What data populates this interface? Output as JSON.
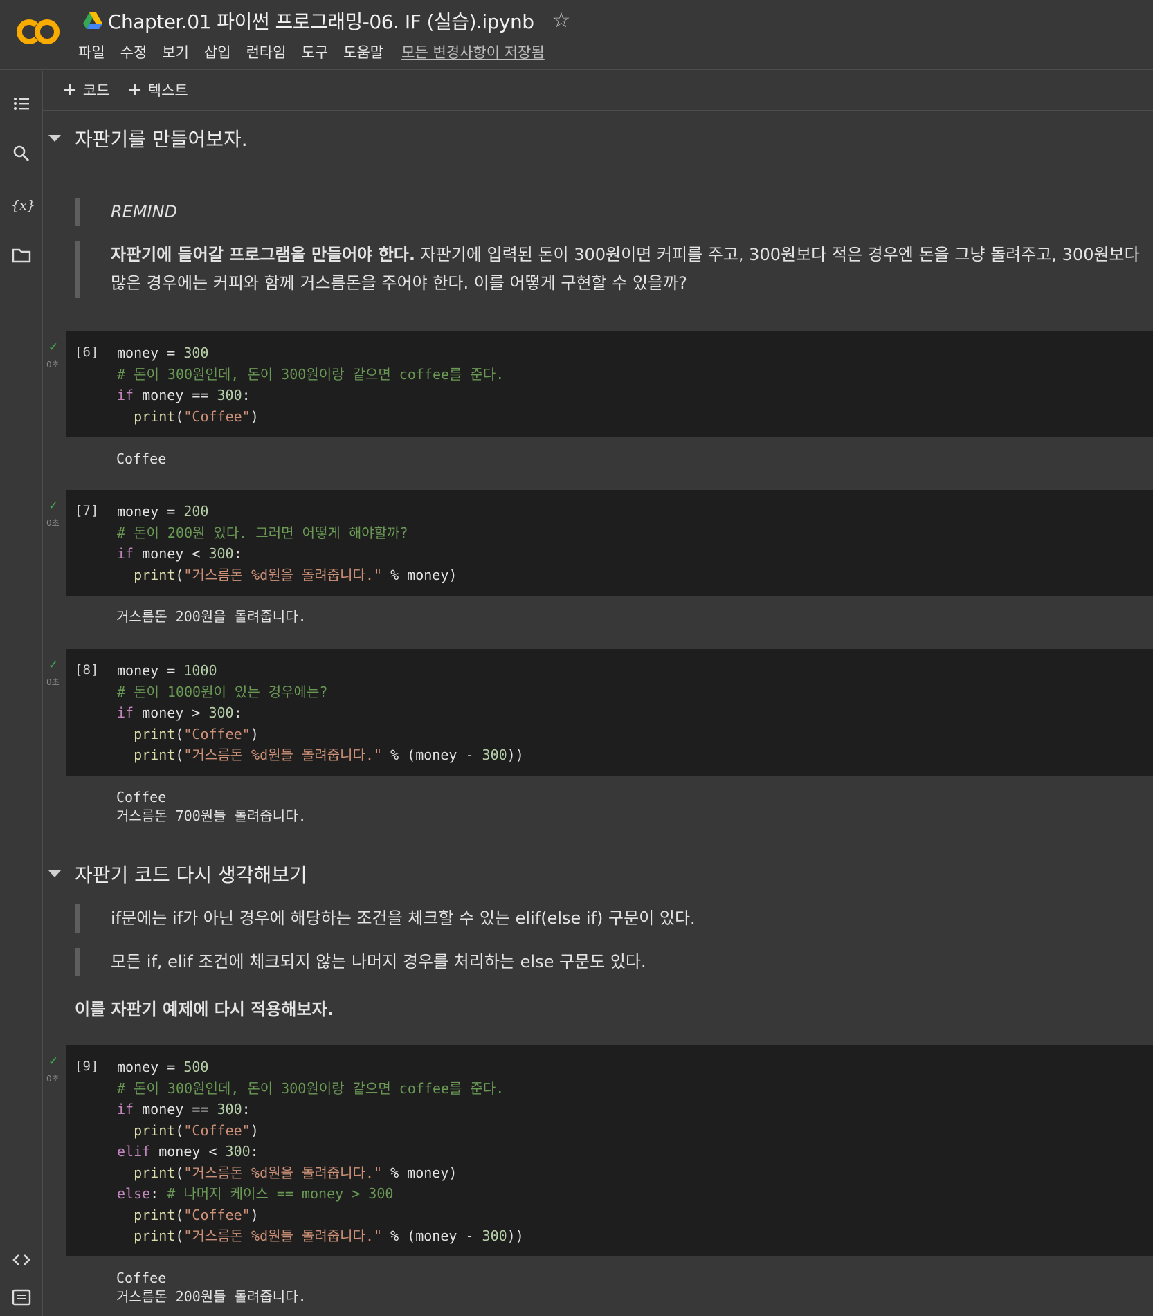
{
  "header": {
    "title": "Chapter.01 파이썬 프로그래밍-06. IF (실습).ipynb",
    "menu": [
      "파일",
      "수정",
      "보기",
      "삽입",
      "런타임",
      "도구",
      "도움말"
    ],
    "saved_status": "모든 변경사항이 저장됨",
    "logo_text": "CO"
  },
  "toolbar": {
    "add_code": "코드",
    "add_text": "텍스트"
  },
  "colors": {
    "accent_orange": "#f9ab00",
    "check_green": "#3fb34f",
    "background": "#383838",
    "code_bg": "#1e1e1e"
  },
  "sections": [
    {
      "heading": "자판기를 만들어보자.",
      "remind": "REMIND",
      "desc_bold": "자판기에 들어갈 프로그램을 만들어야 한다.",
      "desc_line1": " 자판기에 입력된 돈이 300원이면 커피를 주고, 300원보다 적은 경우엔 돈을 그냥 돌려주고, 300원보다",
      "desc_line2": "많은 경우에는 커피와 함께 거스름돈을 주어야 한다. 이를 어떻게 구현할 수 있을까?"
    },
    {
      "heading": "자판기 코드 다시 생각해보기",
      "bq1": "if문에는 if가 아닌 경우에 해당하는 조건을 체크할 수 있는 elif(else if) 구문이 있다.",
      "bq2": "모든 if, elif 조건에 체크되지 않는 나머지 경우를 처리하는 else 구문도 있다.",
      "apply": "이를 자판기 예제에 다시 적용해보자."
    }
  ],
  "cells": [
    {
      "exec": "[6]",
      "time": "0초",
      "lines": [
        [
          [
            "var",
            "money = "
          ],
          [
            "num",
            "300"
          ]
        ],
        [
          [
            "cm",
            "# 돈이 300원인데, 돈이 300원이랑 같으면 coffee를 준다."
          ]
        ],
        [
          [
            "kw",
            "if"
          ],
          [
            "var",
            " money == "
          ],
          [
            "num",
            "300"
          ],
          [
            "var",
            ":"
          ]
        ],
        [
          [
            "var",
            "  "
          ],
          [
            "fn",
            "print"
          ],
          [
            "var",
            "("
          ],
          [
            "str",
            "\"Coffee\""
          ],
          [
            "var",
            ")"
          ]
        ]
      ],
      "output": [
        "Coffee"
      ]
    },
    {
      "exec": "[7]",
      "time": "0초",
      "lines": [
        [
          [
            "var",
            "money = "
          ],
          [
            "num",
            "200"
          ]
        ],
        [
          [
            "cm",
            "# 돈이 200원 있다. 그러면 어떻게 해야할까?"
          ]
        ],
        [
          [
            "kw",
            "if"
          ],
          [
            "var",
            " money < "
          ],
          [
            "num",
            "300"
          ],
          [
            "var",
            ":"
          ]
        ],
        [
          [
            "var",
            "  "
          ],
          [
            "fn",
            "print"
          ],
          [
            "var",
            "("
          ],
          [
            "str",
            "\"거스름돈 %d원을 돌려줍니다.\""
          ],
          [
            "var",
            " % money)"
          ]
        ]
      ],
      "output": [
        "거스름돈 200원을 돌려줍니다."
      ]
    },
    {
      "exec": "[8]",
      "time": "0초",
      "lines": [
        [
          [
            "var",
            "money = "
          ],
          [
            "num",
            "1000"
          ]
        ],
        [
          [
            "cm",
            "# 돈이 1000원이 있는 경우에는?"
          ]
        ],
        [
          [
            "kw",
            "if"
          ],
          [
            "var",
            " money > "
          ],
          [
            "num",
            "300"
          ],
          [
            "var",
            ":"
          ]
        ],
        [
          [
            "var",
            "  "
          ],
          [
            "fn",
            "print"
          ],
          [
            "var",
            "("
          ],
          [
            "str",
            "\"Coffee\""
          ],
          [
            "var",
            ")"
          ]
        ],
        [
          [
            "var",
            "  "
          ],
          [
            "fn",
            "print"
          ],
          [
            "var",
            "("
          ],
          [
            "str",
            "\"거스름돈 %d원들 돌려줍니다.\""
          ],
          [
            "var",
            " % (money - "
          ],
          [
            "num",
            "300"
          ],
          [
            "var",
            "))"
          ]
        ]
      ],
      "output": [
        "Coffee",
        "거스름돈 700원들 돌려줍니다."
      ]
    },
    {
      "exec": "[9]",
      "time": "0초",
      "lines": [
        [
          [
            "var",
            "money = "
          ],
          [
            "num",
            "500"
          ]
        ],
        [
          [
            "cm",
            "# 돈이 300원인데, 돈이 300원이랑 같으면 coffee를 준다."
          ]
        ],
        [
          [
            "kw",
            "if"
          ],
          [
            "var",
            " money == "
          ],
          [
            "num",
            "300"
          ],
          [
            "var",
            ":"
          ]
        ],
        [
          [
            "var",
            "  "
          ],
          [
            "fn",
            "print"
          ],
          [
            "var",
            "("
          ],
          [
            "str",
            "\"Coffee\""
          ],
          [
            "var",
            ")"
          ]
        ],
        [
          [
            "kw",
            "elif"
          ],
          [
            "var",
            " money < "
          ],
          [
            "num",
            "300"
          ],
          [
            "var",
            ":"
          ]
        ],
        [
          [
            "var",
            "  "
          ],
          [
            "fn",
            "print"
          ],
          [
            "var",
            "("
          ],
          [
            "str",
            "\"거스름돈 %d원을 돌려줍니다.\""
          ],
          [
            "var",
            " % money)"
          ]
        ],
        [
          [
            "kw",
            "else"
          ],
          [
            "var",
            ": "
          ],
          [
            "cm",
            "# 나머지 케이스 == money > 300"
          ]
        ],
        [
          [
            "var",
            "  "
          ],
          [
            "fn",
            "print"
          ],
          [
            "var",
            "("
          ],
          [
            "str",
            "\"Coffee\""
          ],
          [
            "var",
            ")"
          ]
        ],
        [
          [
            "var",
            "  "
          ],
          [
            "fn",
            "print"
          ],
          [
            "var",
            "("
          ],
          [
            "str",
            "\"거스름돈 %d원들 돌려줍니다.\""
          ],
          [
            "var",
            " % (money - "
          ],
          [
            "num",
            "300"
          ],
          [
            "var",
            "))"
          ]
        ]
      ],
      "output": [
        "Coffee",
        "거스름돈 200원들 돌려줍니다."
      ]
    }
  ]
}
